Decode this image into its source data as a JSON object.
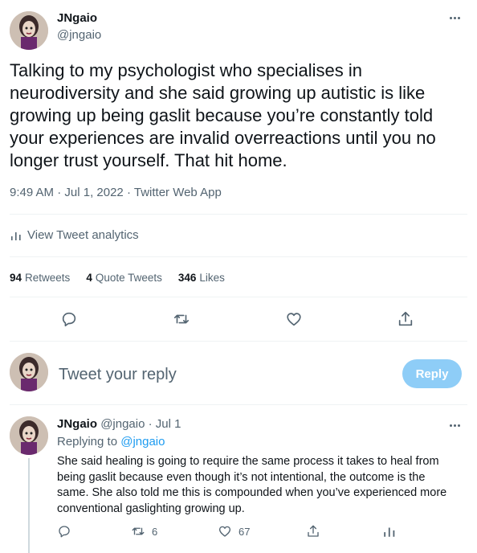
{
  "tweet": {
    "author_name": "JNgaio",
    "author_handle": "@jngaio",
    "text": "Talking to my psychologist who specialises in neurodiversity and she said growing up autistic is like growing up being gaslit because you’re constantly told your experiences are invalid overreactions until you no longer trust yourself. That hit home.",
    "time": "9:49 AM",
    "date": "Jul 1, 2022",
    "source": "Twitter Web App",
    "analytics_label": "View Tweet analytics",
    "stats": {
      "retweets_count": "94",
      "retweets_label": "Retweets",
      "quotes_count": "4",
      "quotes_label": "Quote Tweets",
      "likes_count": "346",
      "likes_label": "Likes"
    }
  },
  "composer": {
    "placeholder": "Tweet your reply",
    "button_label": "Reply"
  },
  "reply": {
    "author_name": "JNgaio",
    "author_handle": "@jngaio",
    "date": "Jul 1",
    "replying_prefix": "Replying to",
    "replying_to": "@jngaio",
    "text": "She said healing is going to require the same process it takes to heal from being gaslit because even though it’s not intentional, the outcome is the same. She also told me this is compounded when you’ve experienced more conventional gaslighting growing up.",
    "retweet_count": "6",
    "like_count": "67"
  },
  "icons": {
    "reply": "reply-icon",
    "retweet": "retweet-icon",
    "like": "heart-icon",
    "share": "share-icon",
    "analytics": "analytics-icon",
    "more": "more-icon"
  },
  "colors": {
    "text": "#0f1419",
    "secondary": "#536471",
    "accent": "#1d9bf0",
    "reply_button_disabled": "#8ecdf7",
    "divider": "#eff3f4"
  }
}
